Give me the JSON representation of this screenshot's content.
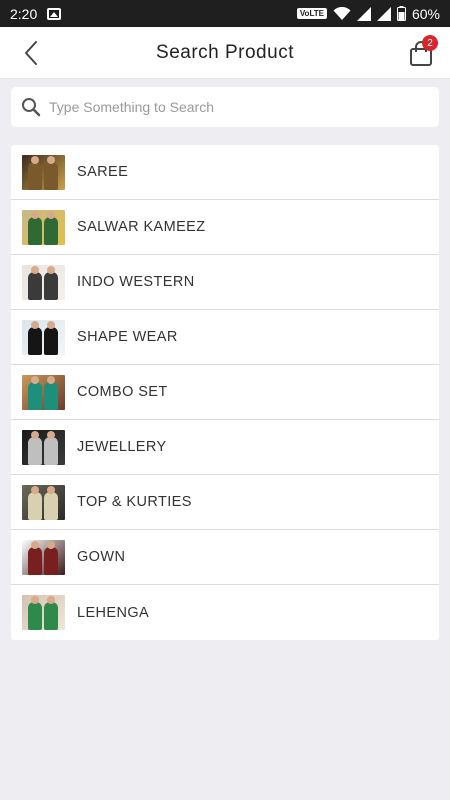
{
  "status_bar": {
    "time": "2:20",
    "network_label": "VoLTE",
    "battery": "60%"
  },
  "header": {
    "title": "Search Product",
    "cart_count": "2"
  },
  "search": {
    "placeholder": "Type Something to Search"
  },
  "categories": [
    {
      "label": "SAREE",
      "thumb_colors": [
        "#3b2a1c",
        "#7a5a2c",
        "#c9a24a"
      ]
    },
    {
      "label": "SALWAR KAMEEZ",
      "thumb_colors": [
        "#c8b88a",
        "#2f6a35",
        "#e3c04a"
      ]
    },
    {
      "label": "INDO WESTERN",
      "thumb_colors": [
        "#e8e4e0",
        "#3a3a3a",
        "#f3efe9"
      ]
    },
    {
      "label": "SHAPE WEAR",
      "thumb_colors": [
        "#d9e6f0",
        "#151515",
        "#f4f4f4"
      ]
    },
    {
      "label": "COMBO SET",
      "thumb_colors": [
        "#c89a5a",
        "#1d8f7a",
        "#6b3a2a"
      ]
    },
    {
      "label": "JEWELLERY",
      "thumb_colors": [
        "#1a1a1a",
        "#bfbfbf",
        "#3a3a3a"
      ]
    },
    {
      "label": "TOP & KURTIES",
      "thumb_colors": [
        "#6a6a5a",
        "#d8d0b0",
        "#2a2a2a"
      ]
    },
    {
      "label": "GOWN",
      "thumb_colors": [
        "#ffffff",
        "#7a1f1f",
        "#3a1a1a"
      ]
    },
    {
      "label": "LEHENGA",
      "thumb_colors": [
        "#d4c2b0",
        "#2e8a4a",
        "#f0e6d8"
      ]
    }
  ]
}
